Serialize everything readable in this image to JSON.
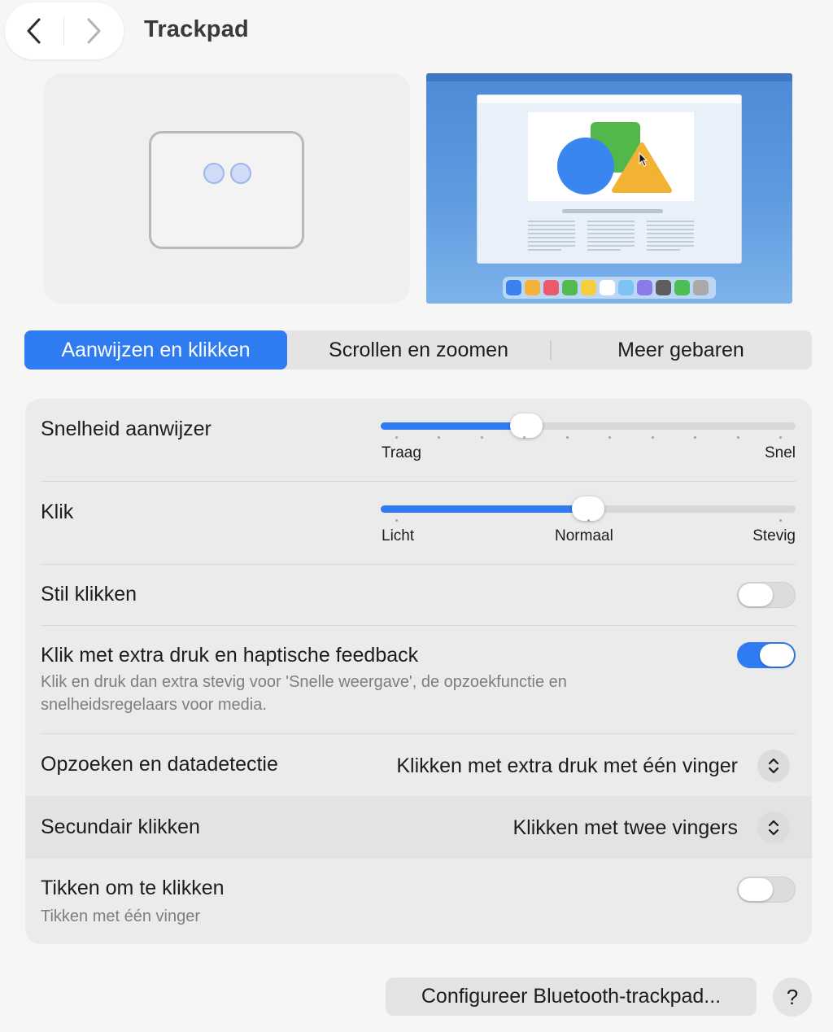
{
  "header": {
    "title": "Trackpad",
    "back_icon": "chevron-left-icon",
    "forward_icon": "chevron-right-icon"
  },
  "tabs": [
    {
      "label": "Aanwijzen en klikken",
      "selected": true
    },
    {
      "label": "Scrollen en zoomen",
      "selected": false
    },
    {
      "label": "Meer gebaren",
      "selected": false
    }
  ],
  "settings": {
    "pointer_speed": {
      "label": "Snelheid aanwijzer",
      "min_label": "Traag",
      "max_label": "Snel",
      "value": 0.35
    },
    "click": {
      "label": "Klik",
      "captions": [
        "Licht",
        "Normaal",
        "Stevig"
      ],
      "value": 0.5
    },
    "silent_click": {
      "label": "Stil klikken",
      "enabled": false
    },
    "force_click": {
      "label": "Klik met extra druk en haptische feedback",
      "description": "Klik en druk dan extra stevig voor 'Snelle weergave', de opzoekfunctie en snelheidsregelaars voor media.",
      "enabled": true
    },
    "lookup": {
      "label": "Opzoeken en datadetectie",
      "value": "Klikken met extra druk met één vinger"
    },
    "secondary_click": {
      "label": "Secundair klikken",
      "value": "Klikken met twee vingers"
    },
    "tap_to_click": {
      "label": "Tikken om te klikken",
      "description": "Tikken met één vinger",
      "enabled": false
    }
  },
  "footer": {
    "bluetooth_button": "Configureer Bluetooth-trackpad...",
    "help_button": "?"
  },
  "colors": {
    "accent": "#2f7bf2",
    "panel": "#ebebeb"
  }
}
